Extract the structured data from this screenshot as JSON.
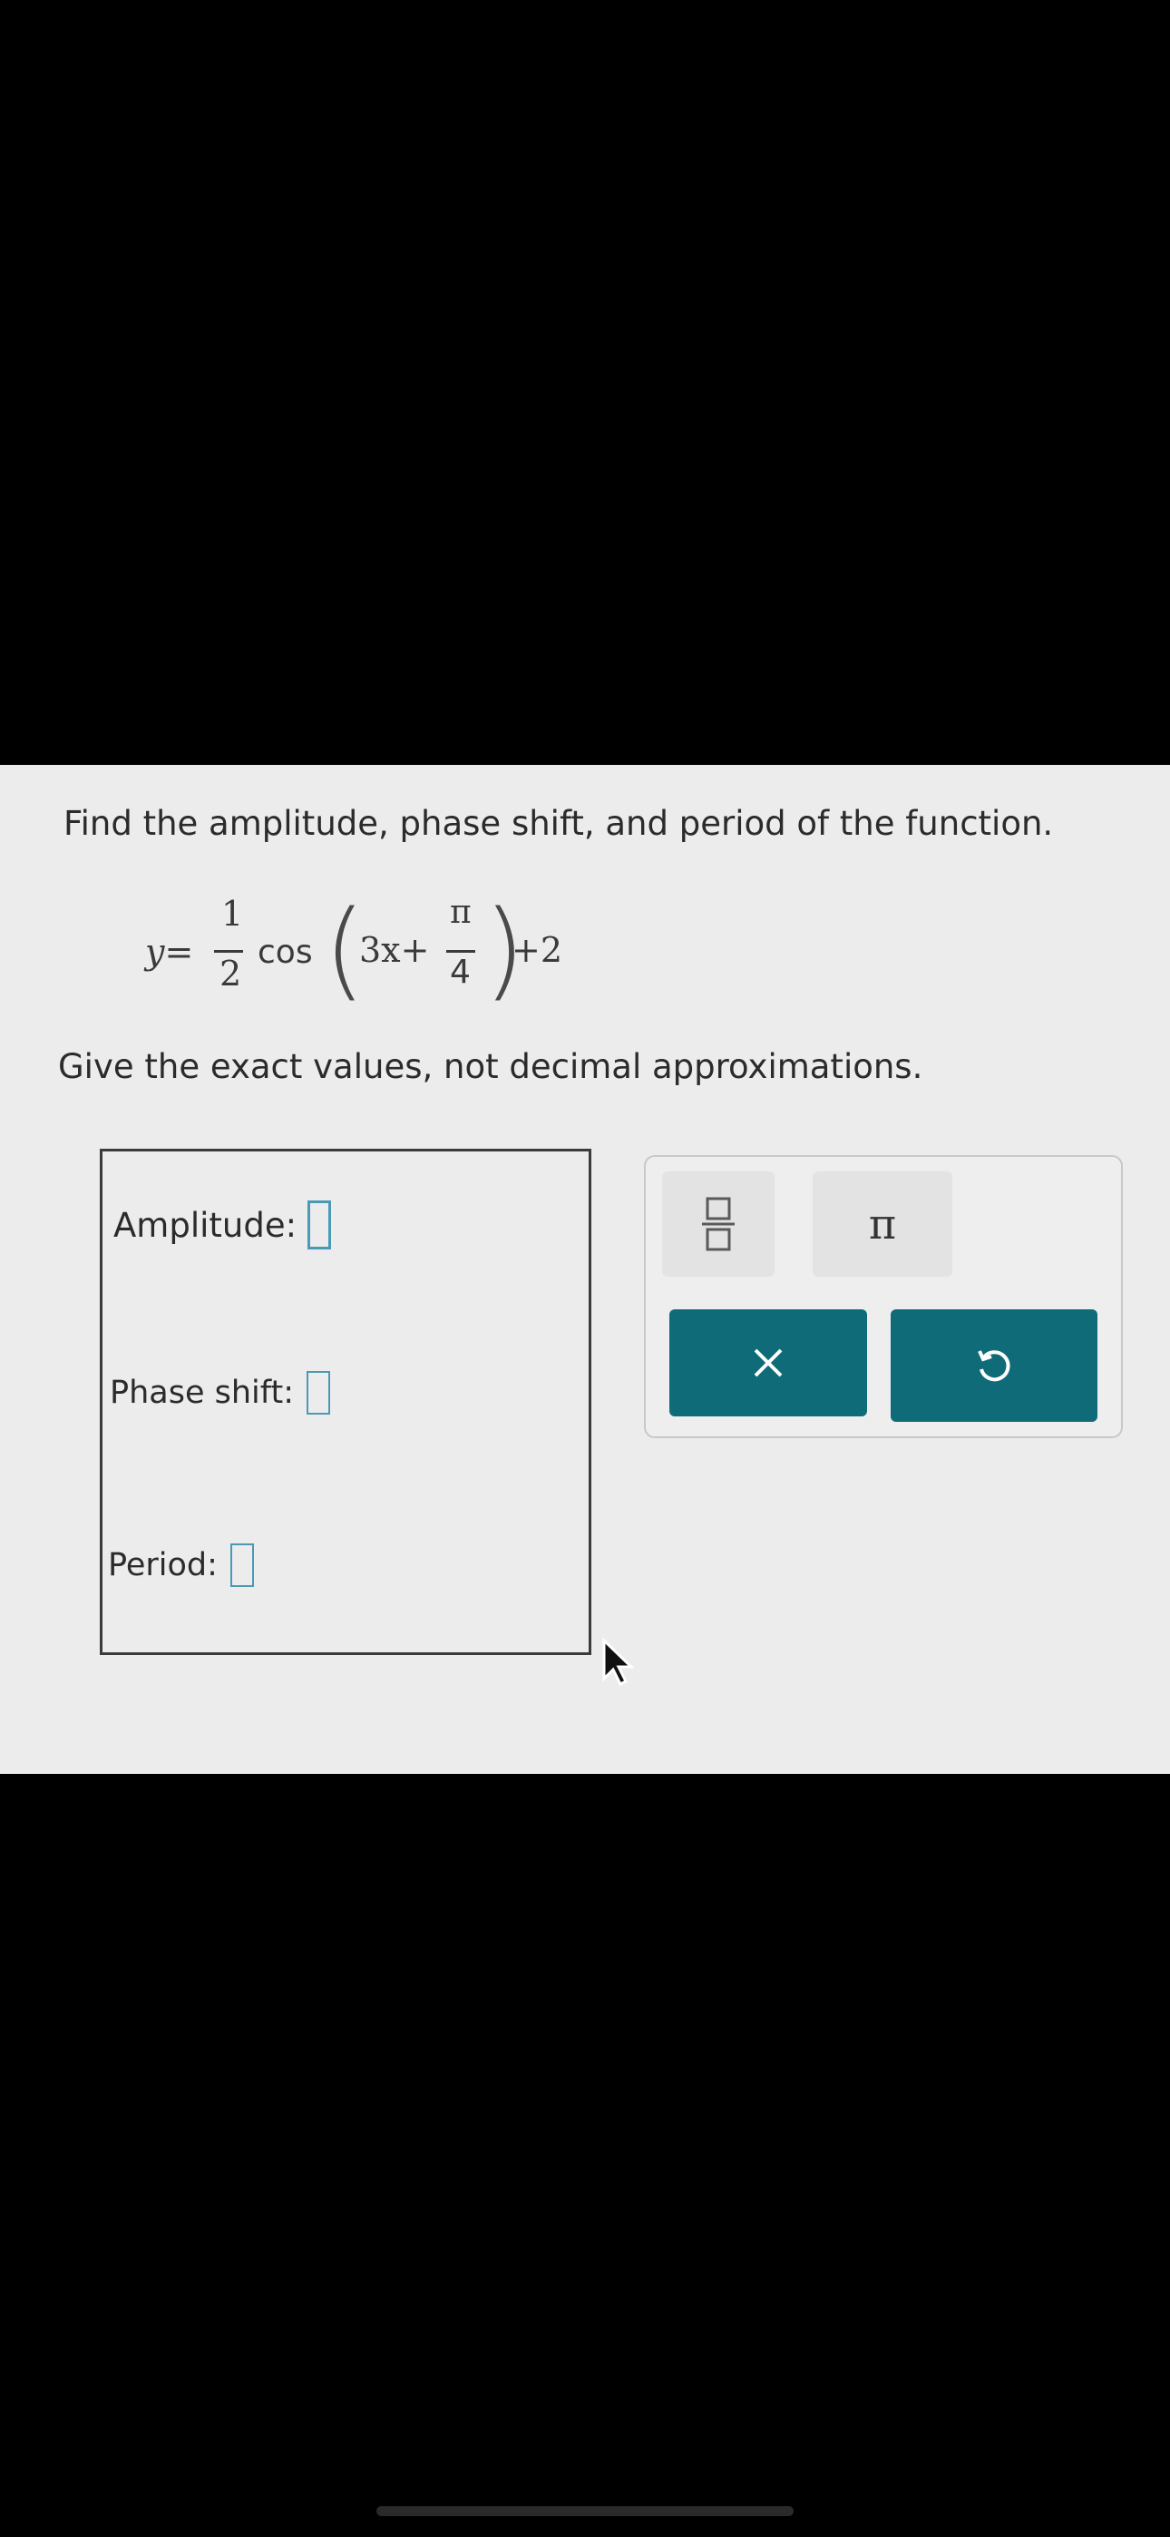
{
  "question": {
    "prompt": "Find the amplitude, phase shift, and period of the function."
  },
  "equation": {
    "lhs": "y=",
    "coef_numerator": "1",
    "coef_denominator": "2",
    "function": "cos",
    "inner_term": "3x+",
    "shift_numerator": "π",
    "shift_denominator": "4",
    "tail": "+2"
  },
  "instruction": "Give the exact values, not decimal approximations.",
  "answers": [
    {
      "label": "Amplitude:",
      "value": ""
    },
    {
      "label": "Phase shift:",
      "value": ""
    },
    {
      "label": "Period:",
      "value": ""
    }
  ],
  "keypad": {
    "keys": [
      {
        "name": "fraction",
        "icon": "fraction-icon"
      },
      {
        "name": "pi",
        "label": "π"
      },
      {
        "name": "clear",
        "icon": "close-icon"
      },
      {
        "name": "undo",
        "icon": "undo-icon"
      }
    ],
    "colors": {
      "action_key": "#0f6b78",
      "input_border": "#4a9ab5"
    }
  }
}
